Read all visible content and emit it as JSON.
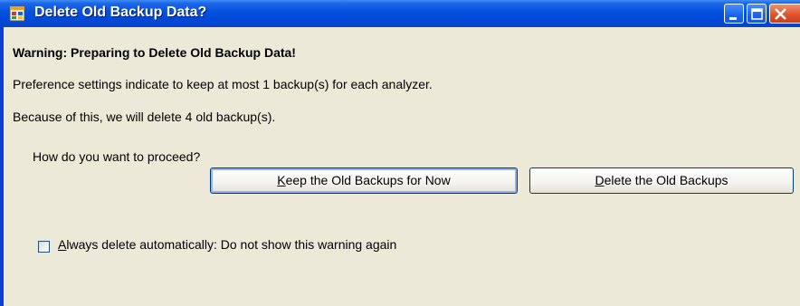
{
  "window": {
    "title": "Delete Old Backup Data?",
    "title_icon": "app-window-icon",
    "controls": [
      "minimize-icon",
      "maximize-icon",
      "close-icon"
    ]
  },
  "dialog": {
    "heading": "Warning: Preparing to Delete Old Backup Data!",
    "message1": "Preference settings indicate to keep at most 1 backup(s) for each analyzer.",
    "message2": "Because of this, we will delete 4 old backup(s).",
    "question": "How do you want to proceed?"
  },
  "buttons": {
    "keep": {
      "mnemonic": "K",
      "rest": "eep the Old Backups for Now"
    },
    "delete": {
      "mnemonic": "D",
      "rest": "elete the Old Backups"
    }
  },
  "checkbox": {
    "mnemonic": "A",
    "rest": "lways delete automatically: Do not show this warning again",
    "checked": false
  },
  "colors": {
    "titlebar": "#0053e0",
    "client_bg": "#ece9d8",
    "close_button": "#e0552c",
    "button_border": "#003c74"
  }
}
